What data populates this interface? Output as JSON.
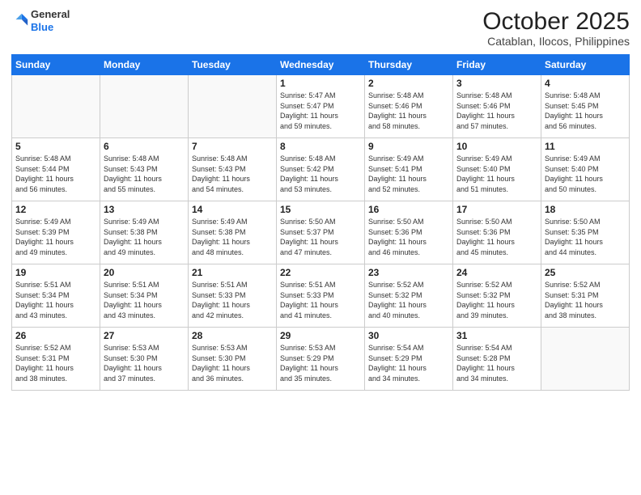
{
  "logo": {
    "general": "General",
    "blue": "Blue"
  },
  "header": {
    "month": "October 2025",
    "location": "Catablan, Ilocos, Philippines"
  },
  "weekdays": [
    "Sunday",
    "Monday",
    "Tuesday",
    "Wednesday",
    "Thursday",
    "Friday",
    "Saturday"
  ],
  "weeks": [
    [
      {
        "day": "",
        "info": ""
      },
      {
        "day": "",
        "info": ""
      },
      {
        "day": "",
        "info": ""
      },
      {
        "day": "1",
        "info": "Sunrise: 5:47 AM\nSunset: 5:47 PM\nDaylight: 11 hours\nand 59 minutes."
      },
      {
        "day": "2",
        "info": "Sunrise: 5:48 AM\nSunset: 5:46 PM\nDaylight: 11 hours\nand 58 minutes."
      },
      {
        "day": "3",
        "info": "Sunrise: 5:48 AM\nSunset: 5:46 PM\nDaylight: 11 hours\nand 57 minutes."
      },
      {
        "day": "4",
        "info": "Sunrise: 5:48 AM\nSunset: 5:45 PM\nDaylight: 11 hours\nand 56 minutes."
      }
    ],
    [
      {
        "day": "5",
        "info": "Sunrise: 5:48 AM\nSunset: 5:44 PM\nDaylight: 11 hours\nand 56 minutes."
      },
      {
        "day": "6",
        "info": "Sunrise: 5:48 AM\nSunset: 5:43 PM\nDaylight: 11 hours\nand 55 minutes."
      },
      {
        "day": "7",
        "info": "Sunrise: 5:48 AM\nSunset: 5:43 PM\nDaylight: 11 hours\nand 54 minutes."
      },
      {
        "day": "8",
        "info": "Sunrise: 5:48 AM\nSunset: 5:42 PM\nDaylight: 11 hours\nand 53 minutes."
      },
      {
        "day": "9",
        "info": "Sunrise: 5:49 AM\nSunset: 5:41 PM\nDaylight: 11 hours\nand 52 minutes."
      },
      {
        "day": "10",
        "info": "Sunrise: 5:49 AM\nSunset: 5:40 PM\nDaylight: 11 hours\nand 51 minutes."
      },
      {
        "day": "11",
        "info": "Sunrise: 5:49 AM\nSunset: 5:40 PM\nDaylight: 11 hours\nand 50 minutes."
      }
    ],
    [
      {
        "day": "12",
        "info": "Sunrise: 5:49 AM\nSunset: 5:39 PM\nDaylight: 11 hours\nand 49 minutes."
      },
      {
        "day": "13",
        "info": "Sunrise: 5:49 AM\nSunset: 5:38 PM\nDaylight: 11 hours\nand 49 minutes."
      },
      {
        "day": "14",
        "info": "Sunrise: 5:49 AM\nSunset: 5:38 PM\nDaylight: 11 hours\nand 48 minutes."
      },
      {
        "day": "15",
        "info": "Sunrise: 5:50 AM\nSunset: 5:37 PM\nDaylight: 11 hours\nand 47 minutes."
      },
      {
        "day": "16",
        "info": "Sunrise: 5:50 AM\nSunset: 5:36 PM\nDaylight: 11 hours\nand 46 minutes."
      },
      {
        "day": "17",
        "info": "Sunrise: 5:50 AM\nSunset: 5:36 PM\nDaylight: 11 hours\nand 45 minutes."
      },
      {
        "day": "18",
        "info": "Sunrise: 5:50 AM\nSunset: 5:35 PM\nDaylight: 11 hours\nand 44 minutes."
      }
    ],
    [
      {
        "day": "19",
        "info": "Sunrise: 5:51 AM\nSunset: 5:34 PM\nDaylight: 11 hours\nand 43 minutes."
      },
      {
        "day": "20",
        "info": "Sunrise: 5:51 AM\nSunset: 5:34 PM\nDaylight: 11 hours\nand 43 minutes."
      },
      {
        "day": "21",
        "info": "Sunrise: 5:51 AM\nSunset: 5:33 PM\nDaylight: 11 hours\nand 42 minutes."
      },
      {
        "day": "22",
        "info": "Sunrise: 5:51 AM\nSunset: 5:33 PM\nDaylight: 11 hours\nand 41 minutes."
      },
      {
        "day": "23",
        "info": "Sunrise: 5:52 AM\nSunset: 5:32 PM\nDaylight: 11 hours\nand 40 minutes."
      },
      {
        "day": "24",
        "info": "Sunrise: 5:52 AM\nSunset: 5:32 PM\nDaylight: 11 hours\nand 39 minutes."
      },
      {
        "day": "25",
        "info": "Sunrise: 5:52 AM\nSunset: 5:31 PM\nDaylight: 11 hours\nand 38 minutes."
      }
    ],
    [
      {
        "day": "26",
        "info": "Sunrise: 5:52 AM\nSunset: 5:31 PM\nDaylight: 11 hours\nand 38 minutes."
      },
      {
        "day": "27",
        "info": "Sunrise: 5:53 AM\nSunset: 5:30 PM\nDaylight: 11 hours\nand 37 minutes."
      },
      {
        "day": "28",
        "info": "Sunrise: 5:53 AM\nSunset: 5:30 PM\nDaylight: 11 hours\nand 36 minutes."
      },
      {
        "day": "29",
        "info": "Sunrise: 5:53 AM\nSunset: 5:29 PM\nDaylight: 11 hours\nand 35 minutes."
      },
      {
        "day": "30",
        "info": "Sunrise: 5:54 AM\nSunset: 5:29 PM\nDaylight: 11 hours\nand 34 minutes."
      },
      {
        "day": "31",
        "info": "Sunrise: 5:54 AM\nSunset: 5:28 PM\nDaylight: 11 hours\nand 34 minutes."
      },
      {
        "day": "",
        "info": ""
      }
    ]
  ]
}
